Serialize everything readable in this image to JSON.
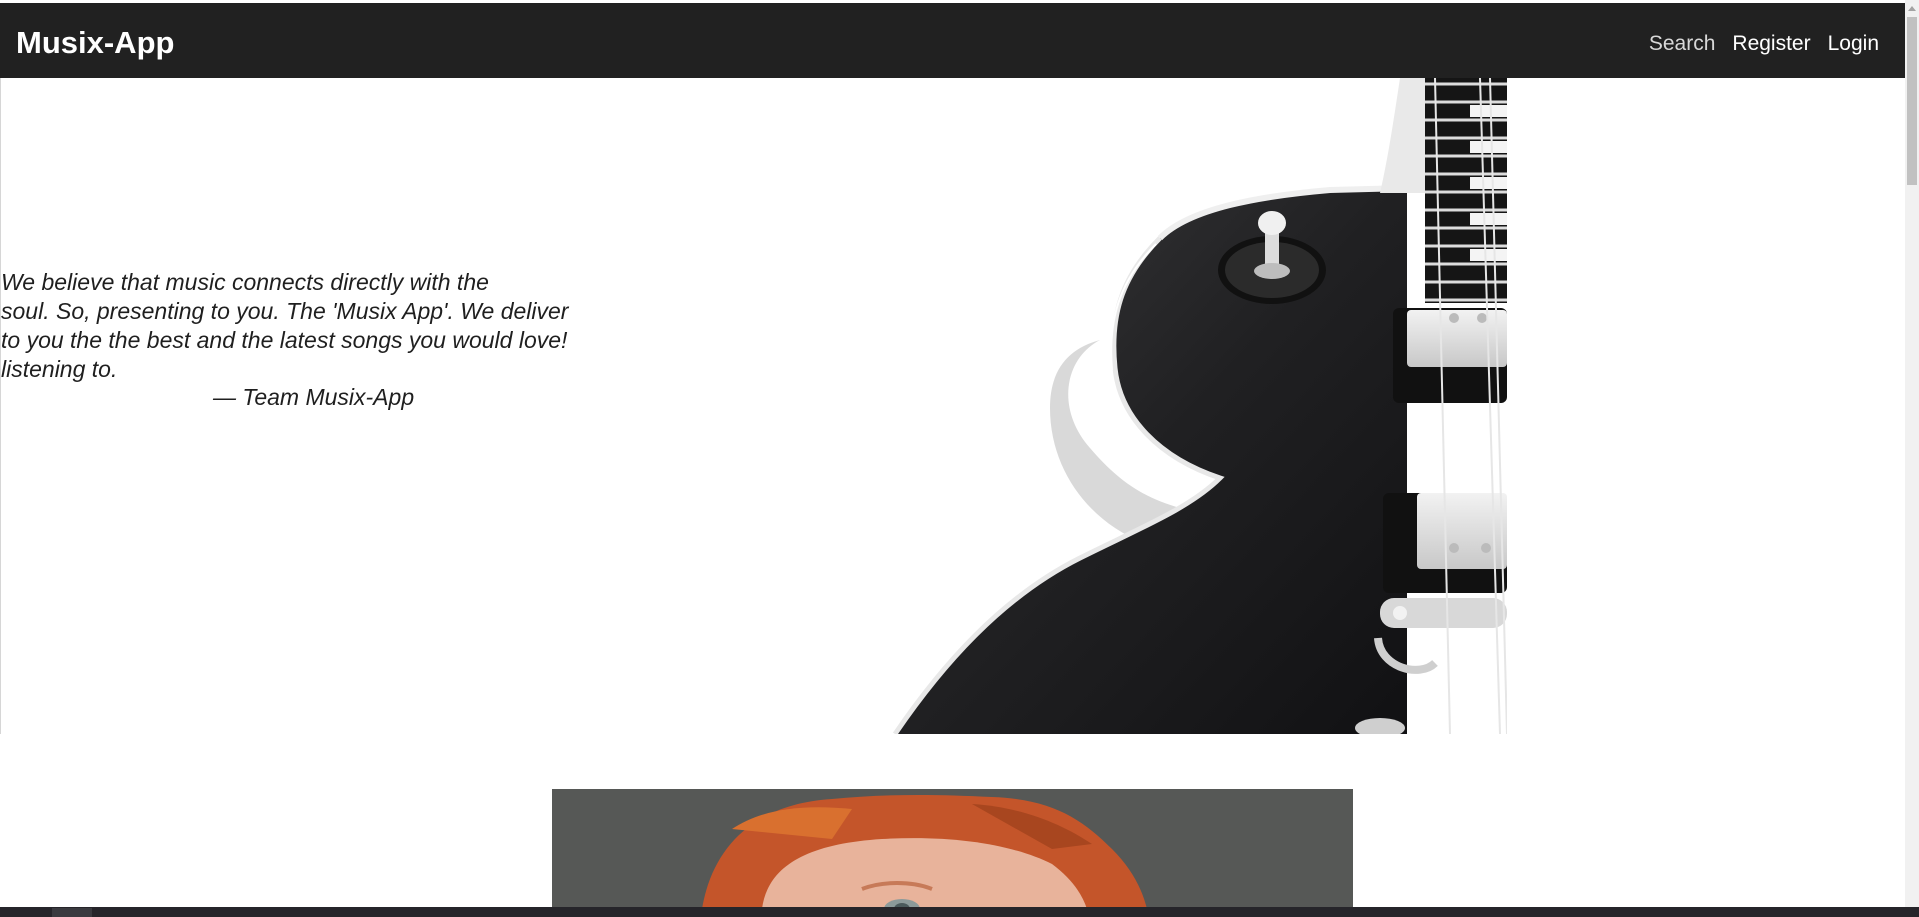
{
  "navbar": {
    "brand": "Musix-App",
    "links": [
      "Search",
      "Register",
      "Login"
    ]
  },
  "hero": {
    "quote_lines": [
      "We believe that music connects directly with the",
      "soul. So, presenting to you. The 'Musix App'. We deliver",
      "to you the the best and the latest songs you would love!",
      "listening to."
    ],
    "author": "— Team Musix-App"
  },
  "colors": {
    "navbar_bg": "#212121",
    "page_bg": "#ffffff",
    "text": "#1f1f1f"
  }
}
